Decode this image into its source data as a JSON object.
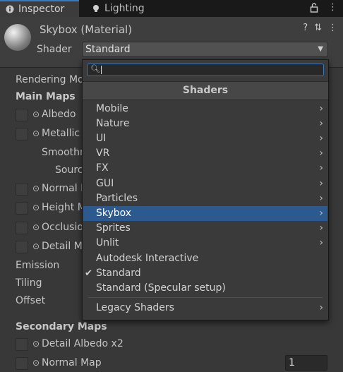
{
  "tabs": {
    "inspector": "Inspector",
    "lighting": "Lighting",
    "lock": "🔓",
    "more": "⋮"
  },
  "header": {
    "title": "Skybox (Material)",
    "shader_label": "Shader",
    "shader_value": "Standard",
    "icons": {
      "help": "?",
      "settings": "⇅",
      "more": "⋮"
    }
  },
  "inspector": {
    "rendering_mode": "Rendering Mo",
    "main_maps": "Main Maps",
    "albedo": "Albedo",
    "metallic": "Metallic",
    "smoothness": "Smoothn",
    "source": "Sourc",
    "normal": "Normal M",
    "height": "Height M",
    "occlusion": "Occlusio",
    "detail_mask": "Detail M",
    "emission": "Emission",
    "tiling": "Tiling",
    "offset": "Offset",
    "secondary_maps": "Secondary Maps",
    "detail_albedo": "Detail Albedo x2",
    "normal_map": "Normal Map",
    "normal_map_value": "1"
  },
  "popup": {
    "search_value": "",
    "header": "Shaders",
    "items": [
      {
        "label": "Mobile",
        "submenu": true,
        "selected": false,
        "checked": false
      },
      {
        "label": "Nature",
        "submenu": true,
        "selected": false,
        "checked": false
      },
      {
        "label": "UI",
        "submenu": true,
        "selected": false,
        "checked": false
      },
      {
        "label": "VR",
        "submenu": true,
        "selected": false,
        "checked": false
      },
      {
        "label": "FX",
        "submenu": true,
        "selected": false,
        "checked": false
      },
      {
        "label": "GUI",
        "submenu": true,
        "selected": false,
        "checked": false
      },
      {
        "label": "Particles",
        "submenu": true,
        "selected": false,
        "checked": false
      },
      {
        "label": "Skybox",
        "submenu": true,
        "selected": true,
        "checked": false
      },
      {
        "label": "Sprites",
        "submenu": true,
        "selected": false,
        "checked": false
      },
      {
        "label": "Unlit",
        "submenu": true,
        "selected": false,
        "checked": false
      },
      {
        "label": "Autodesk Interactive",
        "submenu": false,
        "selected": false,
        "checked": false
      },
      {
        "label": "Standard",
        "submenu": false,
        "selected": false,
        "checked": true
      },
      {
        "label": "Standard (Specular setup)",
        "submenu": false,
        "selected": false,
        "checked": false
      },
      {
        "label": "Legacy Shaders",
        "submenu": true,
        "selected": false,
        "checked": false
      }
    ],
    "chevron": "›",
    "check": "✔"
  },
  "colors": {
    "accent": "#2d5a8e",
    "focus": "#3d75b5",
    "panel": "#383838"
  }
}
